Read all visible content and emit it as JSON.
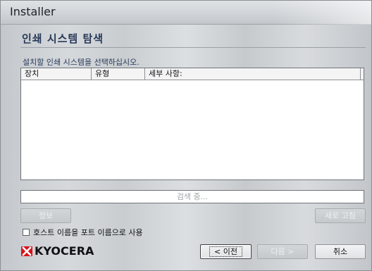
{
  "window": {
    "title": "Installer"
  },
  "page": {
    "heading": "인쇄 시스템 탐색",
    "instruction": "설치할 인쇄 시스템을 선택하십시오."
  },
  "list": {
    "columns": [
      "장치",
      "유형",
      "세부 사항:"
    ],
    "rows": []
  },
  "progress": {
    "status": "검색 중..."
  },
  "buttons": {
    "info": "정보",
    "refresh": "새로 고침",
    "back": "< 이전",
    "next": "다음 >",
    "cancel": "취소"
  },
  "options": {
    "use_hostname_label": "호스트 이름을 포트 이름으로 사용",
    "use_hostname_checked": false
  },
  "brand": {
    "logo_text": "KYOCERA",
    "logo_color": "#d4141c"
  }
}
